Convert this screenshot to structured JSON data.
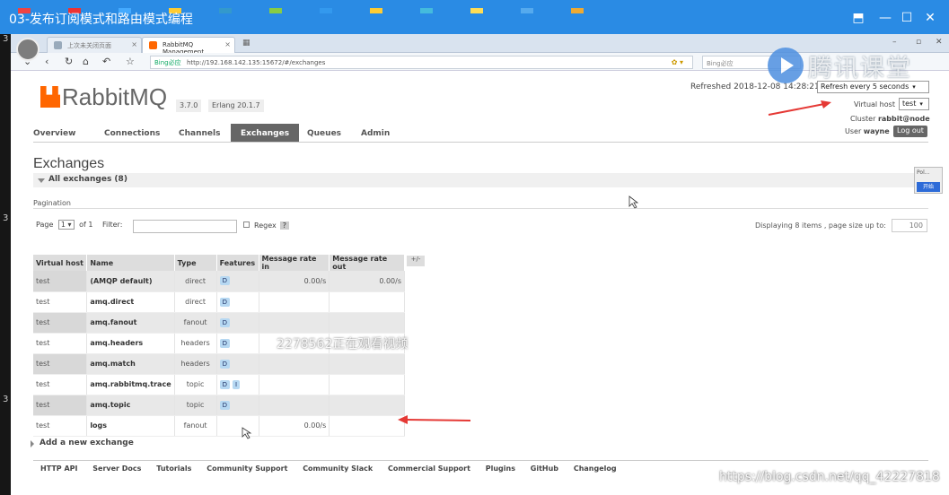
{
  "window": {
    "title": "03-发布订阅模式和路由模式编程",
    "controls": [
      "⬒",
      "—",
      "☐",
      "✕"
    ]
  },
  "browser": {
    "tabs": [
      {
        "label": "上次未关闭页面"
      },
      {
        "label": "RabbitMQ Management"
      }
    ],
    "url": "http://192.168.142.135:15672/#/exchanges",
    "url_prefix": "Bing必应",
    "search_placeholder": "Bing必应"
  },
  "watermark": {
    "brand": "腾讯课堂",
    "viewers": "2278562正在观看视频",
    "csdn": "https://blog.csdn.net/qq_42227818"
  },
  "side_widget": {
    "top": "Pol...",
    "button": "开始"
  },
  "header": {
    "logo": "RabbitMQ",
    "versions": [
      "3.7.0",
      "Erlang 20.1.7"
    ],
    "refreshed": "Refreshed 2018-12-08 14:28:21",
    "refresh_option": "Refresh every 5 seconds",
    "virtual_host_label": "Virtual host",
    "virtual_host_value": "test",
    "cluster_label": "Cluster",
    "cluster_value": "rabbit@node",
    "user_label": "User",
    "user_value": "wayne",
    "logout": "Log out"
  },
  "nav": [
    "Overview",
    "Connections",
    "Channels",
    "Exchanges",
    "Queues",
    "Admin"
  ],
  "page": {
    "heading": "Exchanges",
    "section": "All exchanges (8)",
    "pagination_label": "Pagination",
    "page_label": "Page",
    "page_value": "1",
    "of_label": "of 1",
    "filter_label": "Filter:",
    "regex_label": "Regex",
    "regex_help": "?",
    "displaying": "Displaying 8 items , page size up to:",
    "page_size": "100"
  },
  "table": {
    "columns": [
      "Virtual host",
      "Name",
      "Type",
      "Features",
      "Message rate in",
      "Message rate out"
    ],
    "plus_minus": "+/-",
    "rows": [
      {
        "vhost": "test",
        "name": "(AMQP default)",
        "type": "direct",
        "features": [
          "D"
        ],
        "rate_in": "0.00/s",
        "rate_out": "0.00/s"
      },
      {
        "vhost": "test",
        "name": "amq.direct",
        "type": "direct",
        "features": [
          "D"
        ],
        "rate_in": "",
        "rate_out": ""
      },
      {
        "vhost": "test",
        "name": "amq.fanout",
        "type": "fanout",
        "features": [
          "D"
        ],
        "rate_in": "",
        "rate_out": ""
      },
      {
        "vhost": "test",
        "name": "amq.headers",
        "type": "headers",
        "features": [
          "D"
        ],
        "rate_in": "",
        "rate_out": ""
      },
      {
        "vhost": "test",
        "name": "amq.match",
        "type": "headers",
        "features": [
          "D"
        ],
        "rate_in": "",
        "rate_out": ""
      },
      {
        "vhost": "test",
        "name": "amq.rabbitmq.trace",
        "type": "topic",
        "features": [
          "D",
          "I"
        ],
        "rate_in": "",
        "rate_out": ""
      },
      {
        "vhost": "test",
        "name": "amq.topic",
        "type": "topic",
        "features": [
          "D"
        ],
        "rate_in": "",
        "rate_out": ""
      },
      {
        "vhost": "test",
        "name": "logs",
        "type": "fanout",
        "features": [],
        "rate_in": "0.00/s",
        "rate_out": ""
      }
    ]
  },
  "add_exchange": "Add a new exchange",
  "footer": [
    "HTTP API",
    "Server Docs",
    "Tutorials",
    "Community Support",
    "Community Slack",
    "Commercial Support",
    "Plugins",
    "GitHub",
    "Changelog"
  ],
  "edge_numbers": [
    "3",
    "3",
    "3"
  ],
  "colors": {
    "titlebar": "#2a8be4",
    "accent": "#ff6600",
    "arrow": "#e53935",
    "feature_badge": "#b6d8f2",
    "active_tab": "#666666"
  }
}
